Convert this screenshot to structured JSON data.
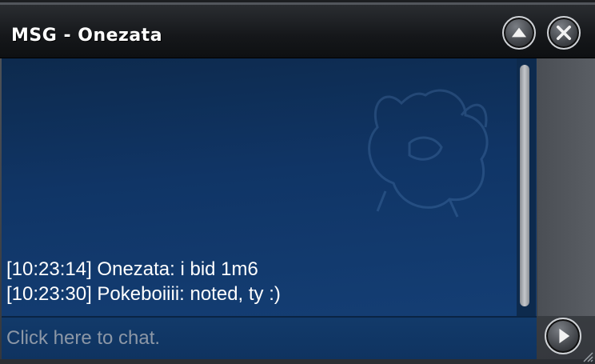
{
  "window": {
    "title": "MSG - Onezata"
  },
  "titlebar_buttons": {
    "minimize_icon": "arrow-up-icon",
    "close_icon": "close-x-icon"
  },
  "chat": {
    "messages": [
      {
        "text": "[10:23:14] Onezata: i bid 1m6"
      },
      {
        "text": "[10:23:30] Pokeboiiii: noted, ty :)"
      }
    ]
  },
  "input": {
    "placeholder": "Click here to chat.",
    "value": ""
  },
  "send_button": {
    "icon": "play-arrow-icon"
  },
  "colors": {
    "panel_bg": "#103566",
    "titlebar_bg": "#15171a",
    "text": "#ffffff",
    "placeholder": "#8c97a6"
  }
}
